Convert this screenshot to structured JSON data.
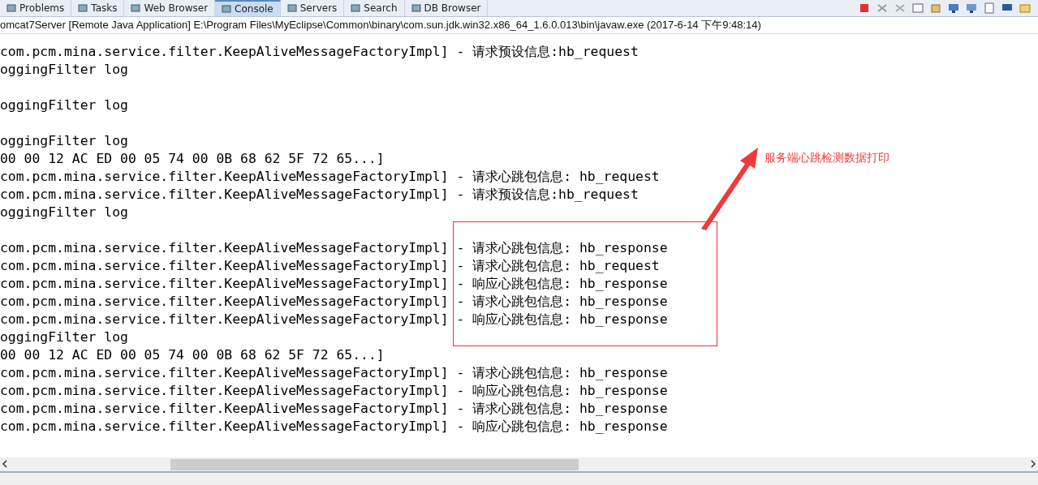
{
  "tabs": [
    {
      "label": "Problems",
      "selected": false
    },
    {
      "label": "Tasks",
      "selected": false
    },
    {
      "label": "Web Browser",
      "selected": false
    },
    {
      "label": "Console",
      "selected": true
    },
    {
      "label": "Servers",
      "selected": false
    },
    {
      "label": "Search",
      "selected": false
    },
    {
      "label": "DB Browser",
      "selected": false
    }
  ],
  "console": {
    "title": "omcat7Server [Remote Java Application] E:\\Program Files\\MyEclipse\\Common\\binary\\com.sun.jdk.win32.x86_64_1.6.0.013\\bin\\javaw.exe (2017-6-14 下午9:48:14)",
    "lines": [
      {
        "kind": "text",
        "text": "com.pcm.mina.service.filter.KeepAliveMessageFactoryImpl] - 请求预设信息:hb_request"
      },
      {
        "kind": "text",
        "text": "oggingFilter log"
      },
      {
        "kind": "blank"
      },
      {
        "kind": "text",
        "text": "oggingFilter log"
      },
      {
        "kind": "blank"
      },
      {
        "kind": "text",
        "text": "oggingFilter log"
      },
      {
        "kind": "text",
        "text": "00 00 12 AC ED 00 05 74 00 0B 68 62 5F 72 65...]"
      },
      {
        "kind": "text",
        "text": "com.pcm.mina.service.filter.KeepAliveMessageFactoryImpl] - 请求心跳包信息: hb_request"
      },
      {
        "kind": "text",
        "text": "com.pcm.mina.service.filter.KeepAliveMessageFactoryImpl] - 请求预设信息:hb_request"
      },
      {
        "kind": "text",
        "text": "oggingFilter log"
      },
      {
        "kind": "blank"
      },
      {
        "kind": "text",
        "text": "com.pcm.mina.service.filter.KeepAliveMessageFactoryImpl] - 请求心跳包信息: hb_response"
      },
      {
        "kind": "text",
        "text": "com.pcm.mina.service.filter.KeepAliveMessageFactoryImpl] - 请求心跳包信息: hb_request"
      },
      {
        "kind": "text",
        "text": "com.pcm.mina.service.filter.KeepAliveMessageFactoryImpl] - 响应心跳包信息: hb_response"
      },
      {
        "kind": "text",
        "text": "com.pcm.mina.service.filter.KeepAliveMessageFactoryImpl] - 请求心跳包信息: hb_response"
      },
      {
        "kind": "text",
        "text": "com.pcm.mina.service.filter.KeepAliveMessageFactoryImpl] - 响应心跳包信息: hb_response"
      },
      {
        "kind": "text",
        "text": "oggingFilter log"
      },
      {
        "kind": "text",
        "text": "00 00 12 AC ED 00 05 74 00 0B 68 62 5F 72 65...]"
      },
      {
        "kind": "text",
        "text": "com.pcm.mina.service.filter.KeepAliveMessageFactoryImpl] - 请求心跳包信息: hb_response"
      },
      {
        "kind": "text",
        "text": "com.pcm.mina.service.filter.KeepAliveMessageFactoryImpl] - 响应心跳包信息: hb_response"
      },
      {
        "kind": "text",
        "text": "com.pcm.mina.service.filter.KeepAliveMessageFactoryImpl] - 请求心跳包信息: hb_response"
      },
      {
        "kind": "text",
        "text": "com.pcm.mina.service.filter.KeepAliveMessageFactoryImpl] - 响应心跳包信息: hb_response"
      }
    ]
  },
  "annotation": {
    "label": "服务端心跳检测数据打印"
  }
}
